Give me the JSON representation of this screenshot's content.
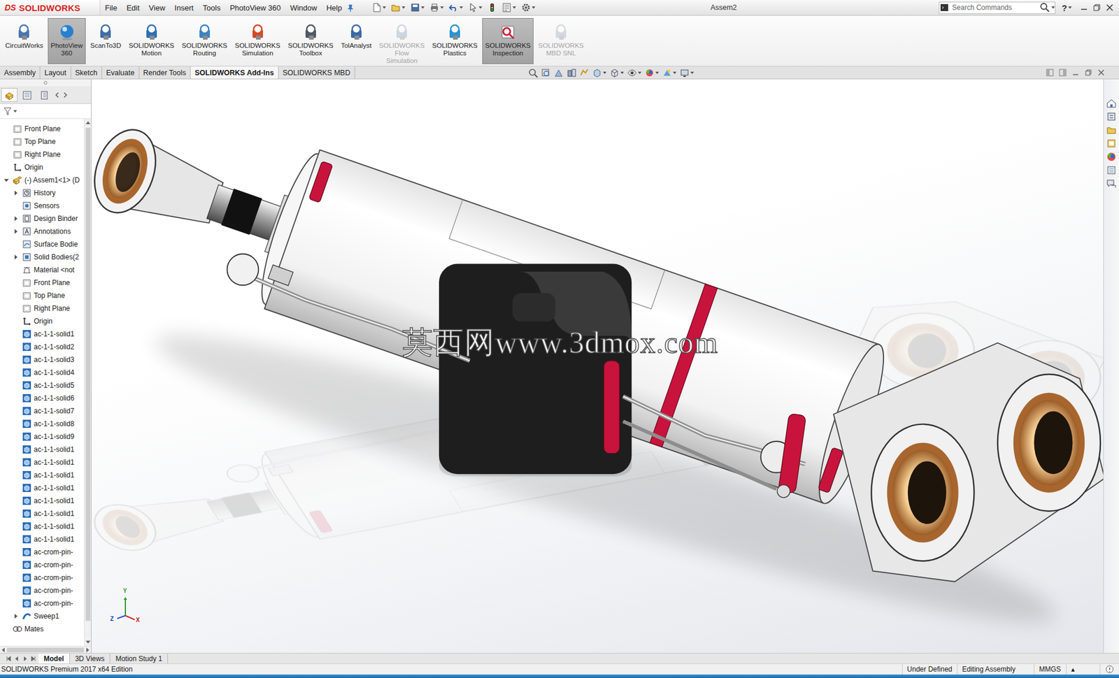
{
  "window": {
    "title": "Assem2"
  },
  "logo": {
    "ds": "DS",
    "name": "SOLIDWORKS"
  },
  "menu": [
    "File",
    "Edit",
    "View",
    "Insert",
    "Tools",
    "PhotoView 360",
    "Window",
    "Help"
  ],
  "search": {
    "placeholder": "Search Commands"
  },
  "help": "?",
  "ribbon": [
    {
      "lines": [
        "CircuitWorks"
      ],
      "selected": false,
      "disabled": false
    },
    {
      "lines": [
        "PhotoView",
        "360"
      ],
      "selected": true,
      "disabled": false
    },
    {
      "lines": [
        "ScanTo3D"
      ],
      "selected": false,
      "disabled": false
    },
    {
      "lines": [
        "SOLIDWORKS",
        "Motion"
      ],
      "selected": false,
      "disabled": false
    },
    {
      "lines": [
        "SOLIDWORKS",
        "Routing"
      ],
      "selected": false,
      "disabled": false
    },
    {
      "lines": [
        "SOLIDWORKS",
        "Simulation"
      ],
      "selected": false,
      "disabled": false
    },
    {
      "lines": [
        "SOLIDWORKS",
        "Toolbox"
      ],
      "selected": false,
      "disabled": false
    },
    {
      "lines": [
        "TolAnalyst"
      ],
      "selected": false,
      "disabled": false
    },
    {
      "lines": [
        "SOLIDWORKS",
        "Flow",
        "Simulation"
      ],
      "selected": false,
      "disabled": true
    },
    {
      "lines": [
        "SOLIDWORKS",
        "Plastics"
      ],
      "selected": false,
      "disabled": false
    },
    {
      "lines": [
        "SOLIDWORKS",
        "Inspection"
      ],
      "selected": true,
      "disabled": false
    },
    {
      "lines": [
        "SOLIDWORKS",
        "MBD SNL"
      ],
      "selected": false,
      "disabled": true
    }
  ],
  "tabs": [
    {
      "label": "Assembly",
      "selected": false
    },
    {
      "label": "Layout",
      "selected": false
    },
    {
      "label": "Sketch",
      "selected": false
    },
    {
      "label": "Evaluate",
      "selected": false
    },
    {
      "label": "Render Tools",
      "selected": false
    },
    {
      "label": "SOLIDWORKS Add-Ins",
      "selected": true
    },
    {
      "label": "SOLIDWORKS MBD",
      "selected": false
    }
  ],
  "tree": {
    "items": [
      {
        "label": "Front Plane",
        "level": 0,
        "kind": "plane",
        "expandable": false,
        "expanded": false
      },
      {
        "label": "Top Plane",
        "level": 0,
        "kind": "plane",
        "expandable": false,
        "expanded": false
      },
      {
        "label": "Right Plane",
        "level": 0,
        "kind": "plane",
        "expandable": false,
        "expanded": false
      },
      {
        "label": "Origin",
        "level": 0,
        "kind": "origin",
        "expandable": false,
        "expanded": false
      },
      {
        "label": "(-) Assem1<1> (D",
        "level": 0,
        "kind": "assembly",
        "expandable": true,
        "expanded": true
      },
      {
        "label": "History",
        "level": 1,
        "kind": "history",
        "expandable": true,
        "expanded": false
      },
      {
        "label": "Sensors",
        "level": 1,
        "kind": "sensors",
        "expandable": false,
        "expanded": false
      },
      {
        "label": "Design Binder",
        "level": 1,
        "kind": "binder",
        "expandable": true,
        "expanded": false
      },
      {
        "label": "Annotations",
        "level": 1,
        "kind": "annotations",
        "expandable": true,
        "expanded": false
      },
      {
        "label": "Surface Bodie",
        "level": 1,
        "kind": "surface",
        "expandable": false,
        "expanded": false
      },
      {
        "label": "Solid Bodies(2",
        "level": 1,
        "kind": "solid-bodies",
        "expandable": true,
        "expanded": false
      },
      {
        "label": "Material <not",
        "level": 1,
        "kind": "material",
        "expandable": false,
        "expanded": false
      },
      {
        "label": "Front Plane",
        "level": 1,
        "kind": "plane",
        "expandable": false,
        "expanded": false
      },
      {
        "label": "Top Plane",
        "level": 1,
        "kind": "plane",
        "expandable": false,
        "expanded": false
      },
      {
        "label": "Right Plane",
        "level": 1,
        "kind": "plane",
        "expandable": false,
        "expanded": false
      },
      {
        "label": "Origin",
        "level": 1,
        "kind": "origin",
        "expandable": false,
        "expanded": false
      },
      {
        "label": "ac-1-1-solid1",
        "level": 1,
        "kind": "part",
        "expandable": false,
        "expanded": false
      },
      {
        "label": "ac-1-1-solid2",
        "level": 1,
        "kind": "part",
        "expandable": false,
        "expanded": false
      },
      {
        "label": "ac-1-1-solid3",
        "level": 1,
        "kind": "part",
        "expandable": false,
        "expanded": false
      },
      {
        "label": "ac-1-1-solid4",
        "level": 1,
        "kind": "part",
        "expandable": false,
        "expanded": false
      },
      {
        "label": "ac-1-1-solid5",
        "level": 1,
        "kind": "part",
        "expandable": false,
        "expanded": false
      },
      {
        "label": "ac-1-1-solid6",
        "level": 1,
        "kind": "part",
        "expandable": false,
        "expanded": false
      },
      {
        "label": "ac-1-1-solid7",
        "level": 1,
        "kind": "part",
        "expandable": false,
        "expanded": false
      },
      {
        "label": "ac-1-1-solid8",
        "level": 1,
        "kind": "part",
        "expandable": false,
        "expanded": false
      },
      {
        "label": "ac-1-1-solid9",
        "level": 1,
        "kind": "part",
        "expandable": false,
        "expanded": false
      },
      {
        "label": "ac-1-1-solid1",
        "level": 1,
        "kind": "part",
        "expandable": false,
        "expanded": false
      },
      {
        "label": "ac-1-1-solid1",
        "level": 1,
        "kind": "part",
        "expandable": false,
        "expanded": false
      },
      {
        "label": "ac-1-1-solid1",
        "level": 1,
        "kind": "part",
        "expandable": false,
        "expanded": false
      },
      {
        "label": "ac-1-1-solid1",
        "level": 1,
        "kind": "part",
        "expandable": false,
        "expanded": false
      },
      {
        "label": "ac-1-1-solid1",
        "level": 1,
        "kind": "part",
        "expandable": false,
        "expanded": false
      },
      {
        "label": "ac-1-1-solid1",
        "level": 1,
        "kind": "part",
        "expandable": false,
        "expanded": false
      },
      {
        "label": "ac-1-1-solid1",
        "level": 1,
        "kind": "part",
        "expandable": false,
        "expanded": false
      },
      {
        "label": "ac-1-1-solid1",
        "level": 1,
        "kind": "part",
        "expandable": false,
        "expanded": false
      },
      {
        "label": "ac-crom-pin-",
        "level": 1,
        "kind": "part",
        "expandable": false,
        "expanded": false
      },
      {
        "label": "ac-crom-pin-",
        "level": 1,
        "kind": "part",
        "expandable": false,
        "expanded": false
      },
      {
        "label": "ac-crom-pin-",
        "level": 1,
        "kind": "part",
        "expandable": false,
        "expanded": false
      },
      {
        "label": "ac-crom-pin-",
        "level": 1,
        "kind": "part",
        "expandable": false,
        "expanded": false
      },
      {
        "label": "ac-crom-pin-",
        "level": 1,
        "kind": "part",
        "expandable": false,
        "expanded": false
      },
      {
        "label": "Sweep1",
        "level": 1,
        "kind": "sweep",
        "expandable": true,
        "expanded": false
      },
      {
        "label": "Mates",
        "level": 0,
        "kind": "mates",
        "expandable": false,
        "expanded": false
      }
    ]
  },
  "viewport": {
    "watermark": "莫西网www.3dmox.com",
    "triad": {
      "x": "X",
      "y": "Y",
      "z": "Z"
    }
  },
  "bottom_tabs": [
    {
      "label": "Model",
      "selected": true
    },
    {
      "label": "3D Views",
      "selected": false
    },
    {
      "label": "Motion Study 1",
      "selected": false
    }
  ],
  "status_bar": {
    "product": "SOLIDWORKS Premium 2017 x64 Edition",
    "items": [
      "Under Defined",
      "Editing Assembly",
      "MMGS"
    ],
    "units_arrow": "▴"
  }
}
